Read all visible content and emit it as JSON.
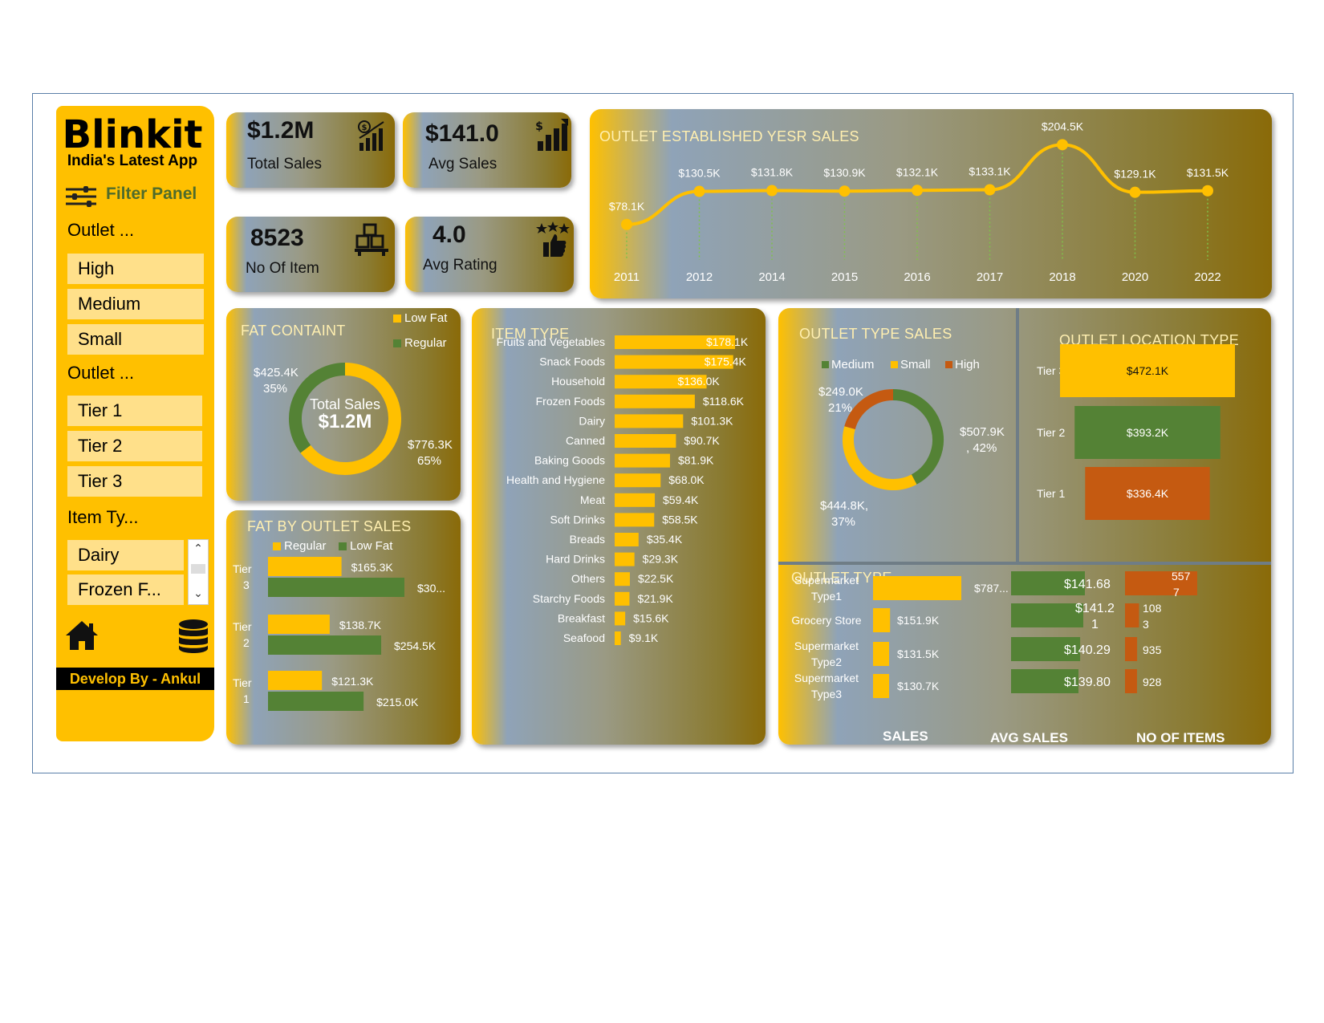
{
  "colors": {
    "yellow": "#ffc000",
    "green": "#548235",
    "orange": "#c55a11",
    "gold_dark": "#8a6a08"
  },
  "sidebar": {
    "brand": "Blinkit",
    "tagline": "India's Latest App",
    "filter_title": "Filter Panel",
    "slicers": [
      {
        "header": "Outlet ...",
        "items": [
          "High",
          "Medium",
          "Small"
        ]
      },
      {
        "header": "Outlet ...",
        "items": [
          "Tier 1",
          "Tier 2",
          "Tier 3"
        ]
      },
      {
        "header": "Item Ty...",
        "items": [
          "Dairy",
          "Frozen F..."
        ]
      }
    ],
    "developer": "Develop By - Ankul",
    "icons": [
      "filter-sliders-icon",
      "home-icon",
      "database-icon",
      "scroll-up-icon",
      "scroll-down-icon"
    ]
  },
  "kpis": [
    {
      "value": "$1.2M",
      "label": "Total Sales",
      "icon": "money-chart-icon"
    },
    {
      "value": "$141.0",
      "label": "Avg Sales",
      "icon": "dollar-growth-icon"
    },
    {
      "value": "8523",
      "label": "No Of Item",
      "icon": "boxes-icon"
    },
    {
      "value": "4.0",
      "label": "Avg Rating",
      "icon": "stars-thumbs-up-icon"
    }
  ],
  "chart_data": [
    {
      "id": "established",
      "type": "line",
      "title": "OUTLET ESTABLISHED YESR SALES",
      "categories": [
        "2011",
        "2012",
        "2014",
        "2015",
        "2016",
        "2017",
        "2018",
        "2020",
        "2022"
      ],
      "values": [
        78.1,
        130.5,
        131.8,
        130.9,
        132.1,
        133.1,
        204.5,
        129.1,
        131.5
      ],
      "labels": [
        "$78.1K",
        "$130.5K",
        "$131.8K",
        "$130.9K",
        "$132.1K",
        "$133.1K",
        "$204.5K",
        "$129.1K",
        "$131.5K"
      ],
      "unit": "$K"
    },
    {
      "id": "fat_content",
      "type": "pie",
      "title": "FAT CONTAINT",
      "legend": [
        "Low Fat",
        "Regular"
      ],
      "slices": [
        {
          "name": "Low Fat",
          "value": 776.3,
          "label": "$776.3K",
          "pct": "65%"
        },
        {
          "name": "Regular",
          "value": 425.4,
          "label": "$425.4K",
          "pct": "35%"
        }
      ],
      "center_title": "Total Sales",
      "center_value": "$1.2M"
    },
    {
      "id": "fat_by_outlet",
      "type": "bar",
      "title": "FAT BY OUTLET SALES",
      "legend": [
        "Regular",
        "Low Fat"
      ],
      "categories": [
        "Tier 3",
        "Tier 2",
        "Tier 1"
      ],
      "category_lines": [
        [
          "Tier",
          "3"
        ],
        [
          "Tier",
          "2"
        ],
        [
          "Tier",
          "1"
        ]
      ],
      "series": [
        {
          "name": "Regular",
          "values": [
            165.3,
            138.7,
            121.3
          ],
          "labels": [
            "$165.3K",
            "$138.7K",
            "$121.3K"
          ]
        },
        {
          "name": "Low Fat",
          "values": [
            306.8,
            254.5,
            215.0
          ],
          "labels": [
            "$30...",
            "$254.5K",
            "$215.0K"
          ]
        }
      ]
    },
    {
      "id": "item_type",
      "type": "bar",
      "title": "ITEM TYPE",
      "categories": [
        "Fruits and Vegetables",
        "Snack Foods",
        "Household",
        "Frozen Foods",
        "Dairy",
        "Canned",
        "Baking Goods",
        "Health and Hygiene",
        "Meat",
        "Soft Drinks",
        "Breads",
        "Hard Drinks",
        "Others",
        "Starchy Foods",
        "Breakfast",
        "Seafood"
      ],
      "values": [
        178.1,
        175.4,
        136.0,
        118.6,
        101.3,
        90.7,
        81.9,
        68.0,
        59.4,
        58.5,
        35.4,
        29.3,
        22.5,
        21.9,
        15.6,
        9.1
      ],
      "labels": [
        "$178.1K",
        "$175.4K",
        "$136.0K",
        "$118.6K",
        "$101.3K",
        "$90.7K",
        "$81.9K",
        "$68.0K",
        "$59.4K",
        "$58.5K",
        "$35.4K",
        "$29.3K",
        "$22.5K",
        "$21.9K",
        "$15.6K",
        "$9.1K"
      ]
    },
    {
      "id": "outlet_type_sales",
      "type": "pie",
      "title": "OUTLET TYPE SALES",
      "legend": [
        "Medium",
        "Small",
        "High"
      ],
      "slices": [
        {
          "name": "Medium",
          "value": 507.9,
          "label": "$507.9K",
          "pct": ", 42%"
        },
        {
          "name": "Small",
          "value": 444.8,
          "label": "$444.8K,",
          "pct": "37%"
        },
        {
          "name": "High",
          "value": 249.0,
          "label": "$249.0K",
          "pct": "21%"
        }
      ]
    },
    {
      "id": "outlet_location",
      "type": "bar",
      "title": "OUTLET  LOCATION TYPE",
      "categories": [
        "Tier 3",
        "Tier 2",
        "Tier 1"
      ],
      "values": [
        472.1,
        393.2,
        336.4
      ],
      "labels": [
        "$472.1K",
        "$393.2K",
        "$336.4K"
      ]
    },
    {
      "id": "outlet_type",
      "type": "table",
      "title": "OUTLET TYPE",
      "column_headers": [
        "SALES",
        "AVG SALES",
        "NO OF ITEMS"
      ],
      "rows": [
        {
          "name_lines": [
            "Supermarket",
            "Type1"
          ],
          "sales": 787.5,
          "sales_label": "$787...",
          "avg": 141.68,
          "avg_lines": [
            "$141.68"
          ],
          "items": 5577,
          "items_lines": [
            "557",
            "7"
          ]
        },
        {
          "name_lines": [
            "Grocery Store"
          ],
          "sales": 151.9,
          "sales_label": "$151.9K",
          "avg": 141.21,
          "avg_lines": [
            "$141.2",
            "1"
          ],
          "items": 1083,
          "items_lines": [
            "108",
            "3"
          ]
        },
        {
          "name_lines": [
            "Supermarket",
            "Type2"
          ],
          "sales": 131.5,
          "sales_label": "$131.5K",
          "avg": 140.29,
          "avg_lines": [
            "$140.29"
          ],
          "items": 935,
          "items_lines": [
            "935"
          ]
        },
        {
          "name_lines": [
            "Supermarket",
            "Type3"
          ],
          "sales": 130.7,
          "sales_label": "$130.7K",
          "avg": 139.8,
          "avg_lines": [
            "$139.80"
          ],
          "items": 928,
          "items_lines": [
            "928"
          ]
        }
      ]
    }
  ]
}
